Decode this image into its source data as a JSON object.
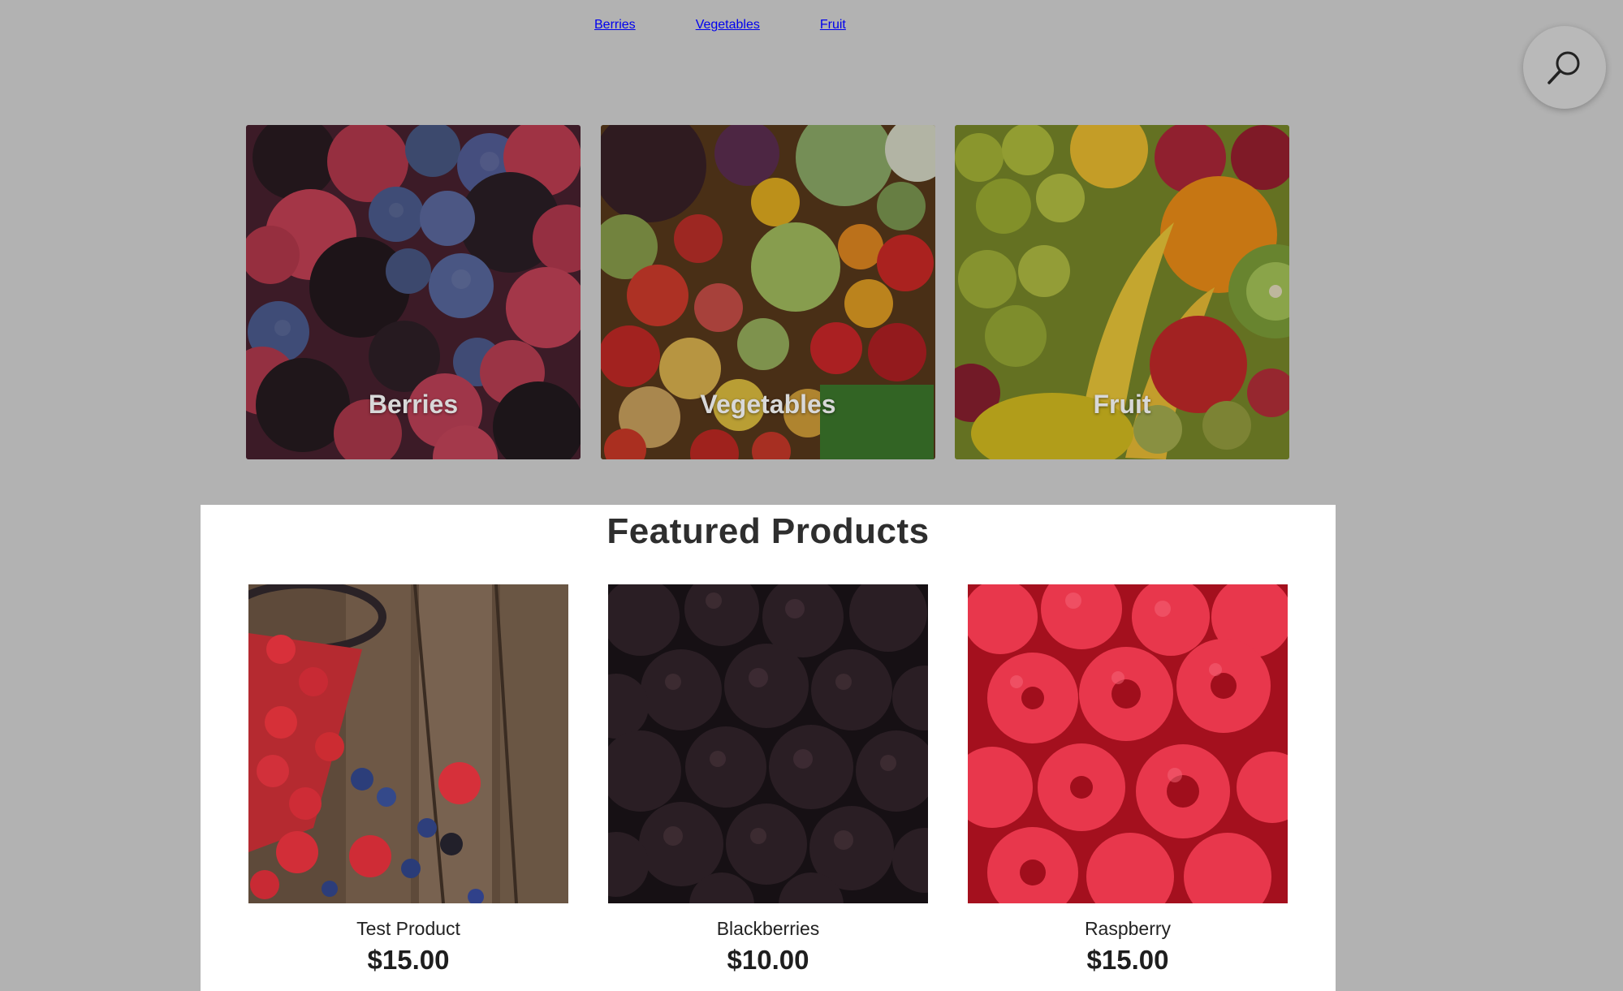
{
  "nav": {
    "items": [
      {
        "label": "Berries"
      },
      {
        "label": "Vegetables"
      },
      {
        "label": "Fruit"
      }
    ]
  },
  "search": {
    "icon": "search-icon"
  },
  "categories": [
    {
      "label": "Berries"
    },
    {
      "label": "Vegetables"
    },
    {
      "label": "Fruit"
    }
  ],
  "featured": {
    "title": "Featured Products",
    "products": [
      {
        "name": "Test Product",
        "price": "$15.00"
      },
      {
        "name": "Blackberries",
        "price": "$10.00"
      },
      {
        "name": "Raspberry",
        "price": "$15.00"
      }
    ]
  },
  "colors": {
    "page_background": "#b2b2b2",
    "panel_background": "#ffffff",
    "text": "#2a2a2a"
  }
}
